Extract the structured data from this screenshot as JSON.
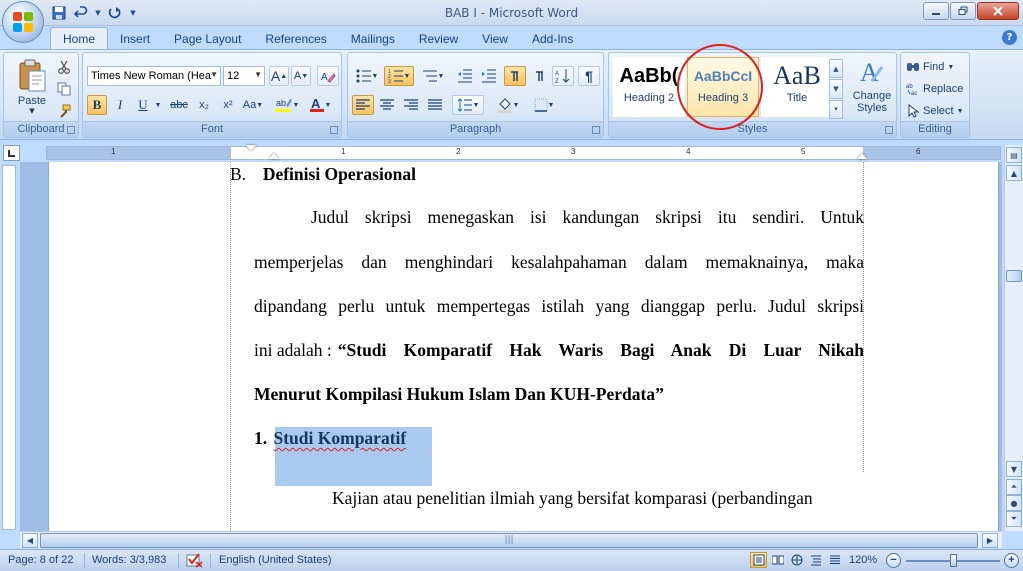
{
  "window": {
    "title": "BAB I - Microsoft Word"
  },
  "tabs": [
    {
      "label": "Home",
      "active": true
    },
    {
      "label": "Insert"
    },
    {
      "label": "Page Layout"
    },
    {
      "label": "References"
    },
    {
      "label": "Mailings"
    },
    {
      "label": "Review"
    },
    {
      "label": "View"
    },
    {
      "label": "Add-Ins"
    }
  ],
  "clipboard": {
    "group_label": "Clipboard",
    "paste_label": "Paste"
  },
  "font": {
    "group_label": "Font",
    "family": "Times New Roman (Hea",
    "size": "12",
    "bold": "B",
    "italic": "I",
    "underline": "U",
    "strike": "abc",
    "subscript": "x₂",
    "superscript": "x²",
    "change_case": "Aa",
    "grow": "A",
    "shrink": "A",
    "font_color_accent": "#e0201a",
    "highlight_accent": "#ffff00"
  },
  "paragraph": {
    "group_label": "Paragraph"
  },
  "styles": {
    "group_label": "Styles",
    "items": [
      {
        "sample": "AaBb(",
        "name": "Heading 2"
      },
      {
        "sample": "AaBbCcI",
        "name": "Heading 3",
        "selected": true
      },
      {
        "sample": "AaB",
        "name": "Title"
      }
    ],
    "change_styles_line1": "Change",
    "change_styles_line2": "Styles"
  },
  "editing": {
    "group_label": "Editing",
    "find": "Find",
    "replace": "Replace",
    "select": "Select"
  },
  "ruler": {
    "numbers": [
      "1",
      "1",
      "2",
      "3",
      "4",
      "5",
      "6"
    ]
  },
  "document": {
    "heading_b_letter": "B.",
    "heading_b_text": "Definisi Operasional",
    "para1_line1": "Judul skripsi menegaskan isi kandungan skripsi itu sendiri. Untuk",
    "para1_line2": "memperjelas dan menghindari kesalahpahaman dalam memaknainya, maka",
    "para1_line3": "dipandang perlu untuk mempertegas istilah yang dianggap perlu. Judul skripsi",
    "para1_line4_pre": "ini adalah : ",
    "para1_line4_bold": "“Studi Komparatif Hak Waris Bagi Anak Di Luar Nikah",
    "para1_line5_bold": "Menurut Kompilasi Hukum Islam Dan KUH-Perdata”",
    "heading_1_num": "1.",
    "heading_1_text": "Studi Komparatif",
    "para2_line1": "Kajian atau penelitian ilmiah yang bersifat komparasi (perbandingan"
  },
  "statusbar": {
    "page": "Page: 8 of 22",
    "words": "Words: 3/3,983",
    "language": "English (United States)",
    "zoom": "120%",
    "zoom_minus": "−",
    "zoom_plus": "+"
  }
}
